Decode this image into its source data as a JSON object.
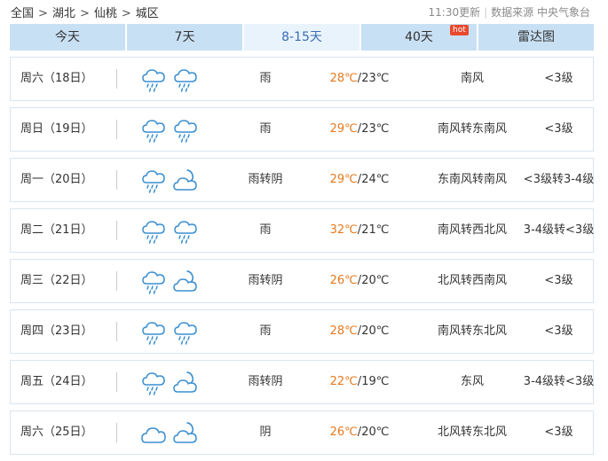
{
  "breadcrumb": {
    "items": [
      "全国",
      "湖北",
      "仙桃",
      "城区"
    ],
    "separator": ">"
  },
  "source": {
    "updated": "11:30更新",
    "divider": "|",
    "text": "数据来源 中央气象台"
  },
  "tabs": [
    {
      "label": "今天",
      "active": false
    },
    {
      "label": "7天",
      "active": false
    },
    {
      "label": "8-15天",
      "active": true
    },
    {
      "label": "40天",
      "active": false,
      "badge": "hot"
    },
    {
      "label": "雷达图",
      "active": false
    }
  ],
  "forecast": [
    {
      "date": "周六（18日）",
      "icons": [
        "rain-cloud-icon",
        "rain-cloud-icon"
      ],
      "weather": "雨",
      "high": "28℃",
      "slash": "/",
      "low": "23℃",
      "wind": "南风",
      "level": "<3级"
    },
    {
      "date": "周日（19日）",
      "icons": [
        "rain-cloud-icon",
        "rain-cloud-icon"
      ],
      "weather": "雨",
      "high": "29℃",
      "slash": "/",
      "low": "23℃",
      "wind": "南风转东南风",
      "level": "<3级"
    },
    {
      "date": "周一（20日）",
      "icons": [
        "rain-cloud-icon",
        "partly-cloudy-night-icon"
      ],
      "weather": "雨转阴",
      "high": "29℃",
      "slash": "/",
      "low": "24℃",
      "wind": "东南风转南风",
      "level": "<3级转3-4级"
    },
    {
      "date": "周二（21日）",
      "icons": [
        "rain-cloud-icon",
        "rain-cloud-icon"
      ],
      "weather": "雨",
      "high": "32℃",
      "slash": "/",
      "low": "21℃",
      "wind": "南风转西北风",
      "level": "3-4级转<3级"
    },
    {
      "date": "周三（22日）",
      "icons": [
        "rain-cloud-icon",
        "partly-cloudy-night-icon"
      ],
      "weather": "雨转阴",
      "high": "26℃",
      "slash": "/",
      "low": "20℃",
      "wind": "北风转西南风",
      "level": "<3级"
    },
    {
      "date": "周四（23日）",
      "icons": [
        "rain-cloud-icon",
        "rain-cloud-icon"
      ],
      "weather": "雨",
      "high": "28℃",
      "slash": "/",
      "low": "20℃",
      "wind": "南风转东北风",
      "level": "<3级"
    },
    {
      "date": "周五（24日）",
      "icons": [
        "rain-cloud-icon",
        "partly-cloudy-night-icon"
      ],
      "weather": "雨转阴",
      "high": "22℃",
      "slash": "/",
      "low": "19℃",
      "wind": "东风",
      "level": "3-4级转<3级"
    },
    {
      "date": "周六（25日）",
      "icons": [
        "cloud-icon",
        "partly-cloudy-night-icon"
      ],
      "weather": "阴",
      "high": "26℃",
      "slash": "/",
      "low": "20℃",
      "wind": "北风转东北风",
      "level": "<3级"
    }
  ],
  "colors": {
    "accent": "#3b6db4",
    "tab_bg": "#c8e0f4",
    "tab_active_bg": "#e9f3fc",
    "high_temp": "#e5791e",
    "icon_stroke": "#3a8fd0",
    "hot_badge": "#e94a2e"
  }
}
